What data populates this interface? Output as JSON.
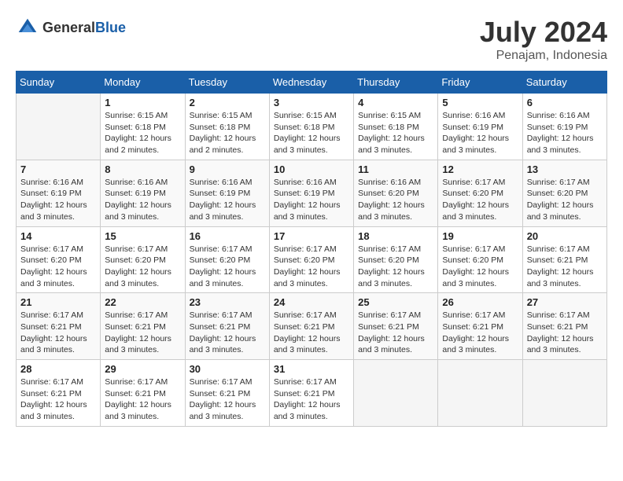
{
  "header": {
    "logo": {
      "general": "General",
      "blue": "Blue"
    },
    "month": "July 2024",
    "location": "Penajam, Indonesia"
  },
  "weekdays": [
    "Sunday",
    "Monday",
    "Tuesday",
    "Wednesday",
    "Thursday",
    "Friday",
    "Saturday"
  ],
  "weeks": [
    [
      {
        "day": "",
        "info": ""
      },
      {
        "day": "1",
        "info": "Sunrise: 6:15 AM\nSunset: 6:18 PM\nDaylight: 12 hours\nand 2 minutes."
      },
      {
        "day": "2",
        "info": "Sunrise: 6:15 AM\nSunset: 6:18 PM\nDaylight: 12 hours\nand 2 minutes."
      },
      {
        "day": "3",
        "info": "Sunrise: 6:15 AM\nSunset: 6:18 PM\nDaylight: 12 hours\nand 3 minutes."
      },
      {
        "day": "4",
        "info": "Sunrise: 6:15 AM\nSunset: 6:18 PM\nDaylight: 12 hours\nand 3 minutes."
      },
      {
        "day": "5",
        "info": "Sunrise: 6:16 AM\nSunset: 6:19 PM\nDaylight: 12 hours\nand 3 minutes."
      },
      {
        "day": "6",
        "info": "Sunrise: 6:16 AM\nSunset: 6:19 PM\nDaylight: 12 hours\nand 3 minutes."
      }
    ],
    [
      {
        "day": "7",
        "info": "Sunrise: 6:16 AM\nSunset: 6:19 PM\nDaylight: 12 hours\nand 3 minutes."
      },
      {
        "day": "8",
        "info": "Sunrise: 6:16 AM\nSunset: 6:19 PM\nDaylight: 12 hours\nand 3 minutes."
      },
      {
        "day": "9",
        "info": "Sunrise: 6:16 AM\nSunset: 6:19 PM\nDaylight: 12 hours\nand 3 minutes."
      },
      {
        "day": "10",
        "info": "Sunrise: 6:16 AM\nSunset: 6:19 PM\nDaylight: 12 hours\nand 3 minutes."
      },
      {
        "day": "11",
        "info": "Sunrise: 6:16 AM\nSunset: 6:20 PM\nDaylight: 12 hours\nand 3 minutes."
      },
      {
        "day": "12",
        "info": "Sunrise: 6:17 AM\nSunset: 6:20 PM\nDaylight: 12 hours\nand 3 minutes."
      },
      {
        "day": "13",
        "info": "Sunrise: 6:17 AM\nSunset: 6:20 PM\nDaylight: 12 hours\nand 3 minutes."
      }
    ],
    [
      {
        "day": "14",
        "info": "Sunrise: 6:17 AM\nSunset: 6:20 PM\nDaylight: 12 hours\nand 3 minutes."
      },
      {
        "day": "15",
        "info": "Sunrise: 6:17 AM\nSunset: 6:20 PM\nDaylight: 12 hours\nand 3 minutes."
      },
      {
        "day": "16",
        "info": "Sunrise: 6:17 AM\nSunset: 6:20 PM\nDaylight: 12 hours\nand 3 minutes."
      },
      {
        "day": "17",
        "info": "Sunrise: 6:17 AM\nSunset: 6:20 PM\nDaylight: 12 hours\nand 3 minutes."
      },
      {
        "day": "18",
        "info": "Sunrise: 6:17 AM\nSunset: 6:20 PM\nDaylight: 12 hours\nand 3 minutes."
      },
      {
        "day": "19",
        "info": "Sunrise: 6:17 AM\nSunset: 6:20 PM\nDaylight: 12 hours\nand 3 minutes."
      },
      {
        "day": "20",
        "info": "Sunrise: 6:17 AM\nSunset: 6:21 PM\nDaylight: 12 hours\nand 3 minutes."
      }
    ],
    [
      {
        "day": "21",
        "info": "Sunrise: 6:17 AM\nSunset: 6:21 PM\nDaylight: 12 hours\nand 3 minutes."
      },
      {
        "day": "22",
        "info": "Sunrise: 6:17 AM\nSunset: 6:21 PM\nDaylight: 12 hours\nand 3 minutes."
      },
      {
        "day": "23",
        "info": "Sunrise: 6:17 AM\nSunset: 6:21 PM\nDaylight: 12 hours\nand 3 minutes."
      },
      {
        "day": "24",
        "info": "Sunrise: 6:17 AM\nSunset: 6:21 PM\nDaylight: 12 hours\nand 3 minutes."
      },
      {
        "day": "25",
        "info": "Sunrise: 6:17 AM\nSunset: 6:21 PM\nDaylight: 12 hours\nand 3 minutes."
      },
      {
        "day": "26",
        "info": "Sunrise: 6:17 AM\nSunset: 6:21 PM\nDaylight: 12 hours\nand 3 minutes."
      },
      {
        "day": "27",
        "info": "Sunrise: 6:17 AM\nSunset: 6:21 PM\nDaylight: 12 hours\nand 3 minutes."
      }
    ],
    [
      {
        "day": "28",
        "info": "Sunrise: 6:17 AM\nSunset: 6:21 PM\nDaylight: 12 hours\nand 3 minutes."
      },
      {
        "day": "29",
        "info": "Sunrise: 6:17 AM\nSunset: 6:21 PM\nDaylight: 12 hours\nand 3 minutes."
      },
      {
        "day": "30",
        "info": "Sunrise: 6:17 AM\nSunset: 6:21 PM\nDaylight: 12 hours\nand 3 minutes."
      },
      {
        "day": "31",
        "info": "Sunrise: 6:17 AM\nSunset: 6:21 PM\nDaylight: 12 hours\nand 3 minutes."
      },
      {
        "day": "",
        "info": ""
      },
      {
        "day": "",
        "info": ""
      },
      {
        "day": "",
        "info": ""
      }
    ]
  ]
}
